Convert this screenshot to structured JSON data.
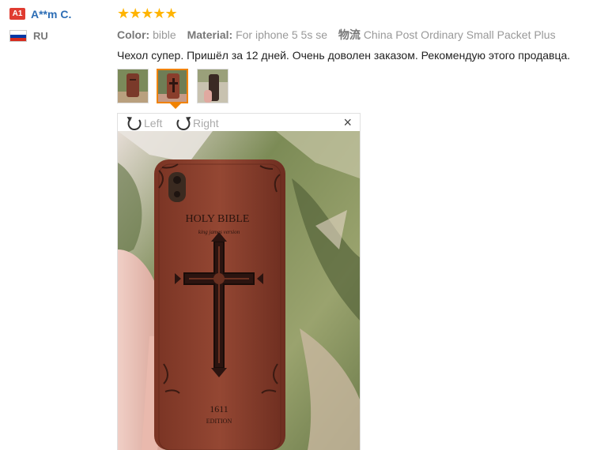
{
  "reviewer": {
    "rank_badge": "A1",
    "name": "A**m C.",
    "country": "RU"
  },
  "review": {
    "stars": "★★★★★",
    "rating": 5,
    "color_label": "Color:",
    "color_value": "bible",
    "material_label": "Material:",
    "material_value": "For iphone 5 5s se",
    "logistics_label": "物流",
    "logistics_value": "China Post Ordinary Small Packet Plus",
    "feedback_text": "Чехол супер. Пришёл за 12 дней. Очень доволен заказом. Рекомендую этого продавца."
  },
  "thumbnails": {
    "count": 3,
    "active_index": 1
  },
  "viewer": {
    "rotate_left_label": "Left",
    "rotate_right_label": "Right",
    "close_label": "×",
    "case_title": "HOLY BIBLE",
    "case_subtitle": "king james version",
    "case_year": "1611",
    "case_edition": "EDITION"
  },
  "colors": {
    "star": "#ffb400",
    "link": "#2c6db5",
    "badge": "#e03c31",
    "active_thumb": "#f08200",
    "case_wood": "#8a3e2c"
  }
}
